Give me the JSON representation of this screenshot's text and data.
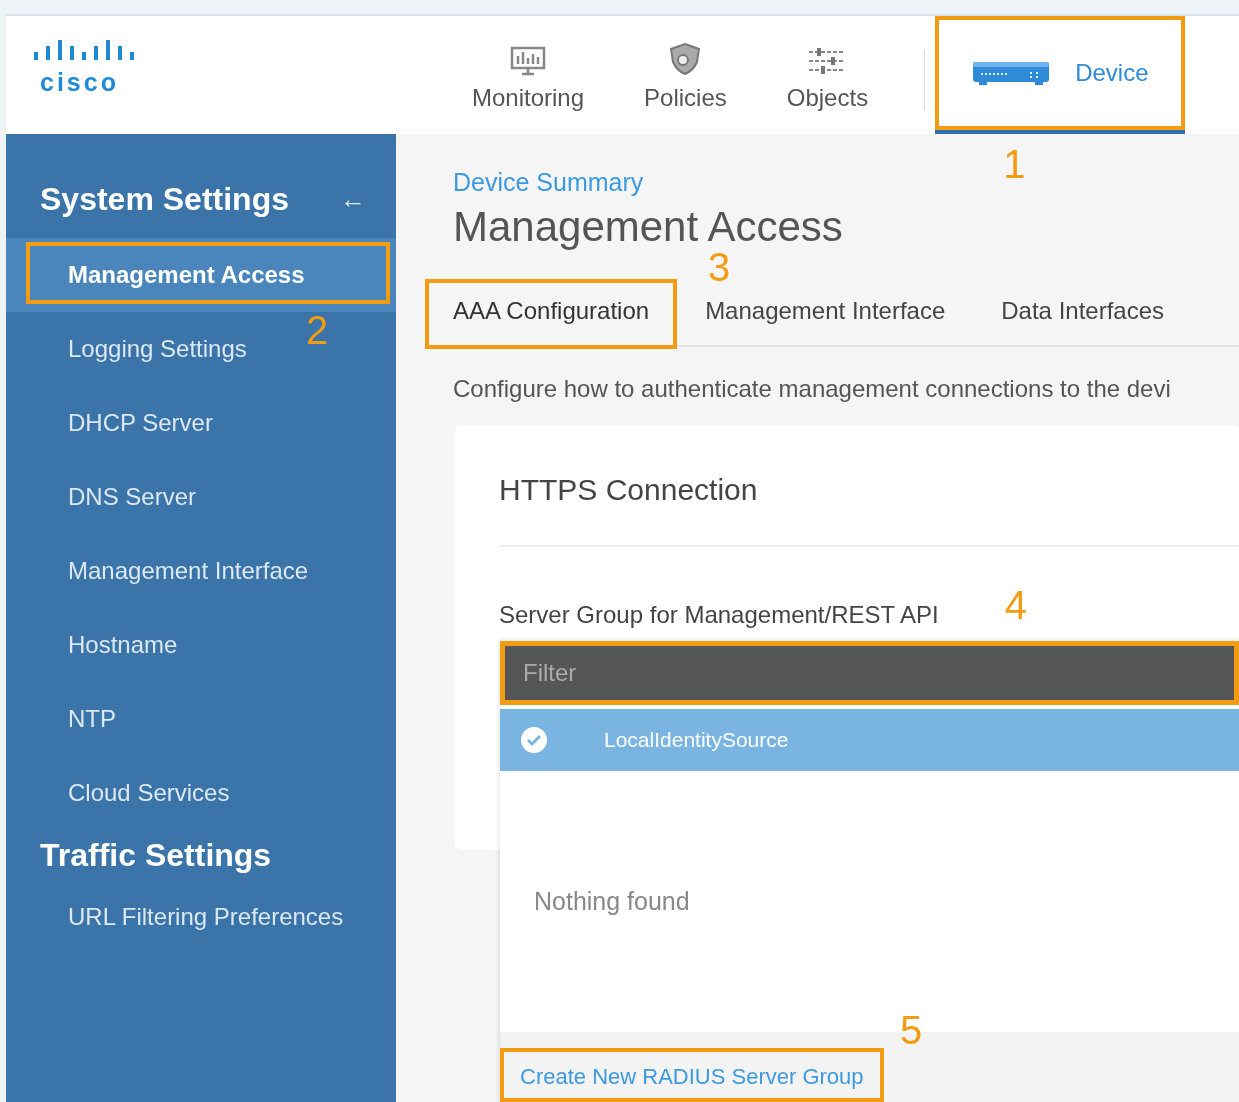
{
  "header": {
    "logo": "cisco",
    "nav": [
      {
        "label": "Monitoring",
        "kind": "monitoring",
        "selected": false
      },
      {
        "label": "Policies",
        "kind": "policies",
        "selected": false
      },
      {
        "label": "Objects",
        "kind": "objects",
        "selected": false
      },
      {
        "label": "Device",
        "kind": "device",
        "selected": true,
        "callout": "1"
      }
    ]
  },
  "sidebar": {
    "sections": [
      {
        "title": "System Settings",
        "collapse": "←",
        "items": [
          {
            "label": "Management Access",
            "selected": true,
            "callout": "2"
          },
          {
            "label": "Logging Settings",
            "selected": false
          },
          {
            "label": "DHCP Server",
            "selected": false
          },
          {
            "label": "DNS Server",
            "selected": false
          },
          {
            "label": "Management Interface",
            "selected": false
          },
          {
            "label": "Hostname",
            "selected": false
          },
          {
            "label": "NTP",
            "selected": false
          },
          {
            "label": "Cloud Services",
            "selected": false
          }
        ]
      },
      {
        "title": "Traffic Settings",
        "items": [
          {
            "label": "URL Filtering Preferences",
            "selected": false
          }
        ]
      }
    ]
  },
  "content": {
    "breadcrumb": "Device Summary",
    "title": "Management Access",
    "tabs": [
      {
        "label": "AAA Configuration",
        "selected": true,
        "callout": "3"
      },
      {
        "label": "Management Interface",
        "selected": false
      },
      {
        "label": "Data Interfaces",
        "selected": false
      }
    ],
    "description": "Configure how to authenticate management connections to the devi",
    "card": {
      "title": "HTTPS Connection",
      "field_label": "Server Group for Management/REST API",
      "dropdown": {
        "filter_placeholder": "Filter",
        "filter_callout": "4",
        "options": [
          {
            "label": "LocalIdentitySource",
            "selected": true
          }
        ],
        "empty_text": "Nothing found",
        "create_link": "Create New RADIUS Server Group",
        "create_callout": "5"
      }
    }
  }
}
